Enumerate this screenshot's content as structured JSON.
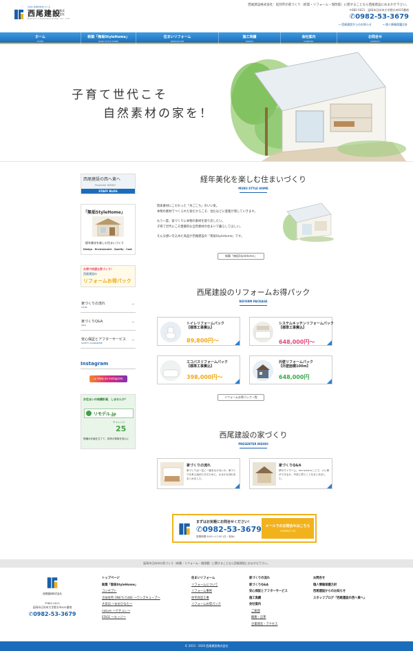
{
  "header": {
    "logo_tag": "九州に住宅文化をつくる",
    "logo_name": "西尾建設",
    "logo_suffix": "株式\n会社",
    "logo_en": "NISHIO CONSTRUCTION CO.,LTD",
    "intro": "西尾建設株式会社：延岡市の家づくり（新築・リフォーム・増改築）に関することなら西尾建設におまかせ下さい。",
    "address": "〒882-0021　延岡市日向市大字野方寺635番地",
    "phone": "0982-53-3679",
    "link_contact": "→ 西尾建設からのお知らせ",
    "link_privacy": "→ 個人情報保護方針"
  },
  "nav": [
    {
      "jp": "ホーム",
      "en": "HOME"
    },
    {
      "jp": "新築「無垢StyleHome」",
      "en": "MUKU STYLE HOME"
    },
    {
      "jp": "住まいリフォーム",
      "en": "RENOVATION"
    },
    {
      "jp": "施工実績",
      "en": "WORKS"
    },
    {
      "jp": "会社案内",
      "en": "COMPANY"
    },
    {
      "jp": "お問合せ",
      "en": "CONTACT"
    }
  ],
  "hero": {
    "copy_line1": "子育て世代こそ",
    "copy_line2": "自然素材の家を！"
  },
  "sidebar": {
    "blog_banner_title": "西尾建設の西へ東へ",
    "blog_banner_sub": "Presenter NISHIO",
    "blog_banner_en": "STAFF BLOG",
    "muku_banner_title": "「無垢StyleHome」",
    "muku_banner_sub": "経年美化を楽しむ住まいづくり",
    "muku_banner_en": "Design . Environment . Quality . Cost",
    "reform_banner_top": "お得で快適な家づくり！",
    "reform_banner_mid": "西尾建設の",
    "reform_banner_main": "リフォームお得パック",
    "menu": [
      {
        "jp": "家づくりの流れ",
        "en": "FLOW"
      },
      {
        "jp": "家づくりQ&A",
        "en": "Q&A"
      },
      {
        "jp": "安心保証とアフターサービス",
        "en": "SAFETY GUARANTEE"
      }
    ],
    "instagram_heading": "Instagram",
    "instagram_button": "View on Instagram",
    "remodel_text1": "お住まいの修繕計画、しませんか？",
    "remodel_brand": "リモデル.jp",
    "remodel_challenge": "チャレンジ",
    "remodel_num": "25",
    "remodel_text2": "修繕の計画を立てて、将来の費用を安心に"
  },
  "muku": {
    "title": "経年美化を楽しむ住まいづくり",
    "subtitle": "MUKU STYLE HOME",
    "p1a": "無垢素材にこだわった「木ごこち」のいい家。",
    "p1b": "本物の素材でつくられた家だからこそ、住むほどに愛着が増していきます。",
    "p2a": "もう一度、家づくりに本物の素材を取り戻したい。",
    "p2b": "子育て世代にこそ健康的な自然素材の住まいで暮らしてほしい。",
    "p3": "そんな想いを込めた商品が西尾建設の「無垢StyleHome」です。",
    "button": "新築「無垢StyleHome」"
  },
  "reform": {
    "title": "西尾建設のリフォームお得パック",
    "subtitle": "REFORM PACKAGE",
    "packs": [
      {
        "name": "トイレリフォームパック\n【標準工事費込】",
        "price": "89,800円〜",
        "color": "#f2a818"
      },
      {
        "name": "システムキッチンリフォームパック\n【標準工事費込】",
        "price": "648,000円〜",
        "color": "#e8457a"
      },
      {
        "name": "エコバスリフォームパック\n【標準工事費込】",
        "price": "398,000円〜",
        "color": "#f2a818"
      },
      {
        "name": "外壁リフォームパック\n【外壁面積100m】",
        "price": "648,000円",
        "color": "#3aa84b"
      }
    ],
    "button": "リフォームお得パック一覧"
  },
  "home": {
    "title": "西尾建設の家づくり",
    "subtitle": "PRESENTER NISHIO",
    "cards": [
      {
        "title": "家づくりの流れ",
        "text": "家づくりは一生に一度あるかないか。家づくりを考え始めた方のために、大まかな流れをまとめました。"
      },
      {
        "title": "家づくりQ&A",
        "text": "夢のマイホーム。построитьことで、いい家ができるか、不安に思うことをまとめました。"
      }
    ]
  },
  "contact": {
    "lead": "まずはお気軽にお問合せください！",
    "phone": "0982-53-3679",
    "hours": "営業時間 8:00〜17:00 (日・祝休)",
    "mail_button": "メールでのお問合せはこちら",
    "mail_en": "CONTACT US"
  },
  "footer": {
    "band": "延岡市日向市の家づくり（新築・リフォーム・増改築）に関することなら西尾建設におまかせ下さい。",
    "logo_caption": "西尾建設株式会社",
    "zip": "〒882-0021",
    "address": "延岡市日向市大字野方寺635番地",
    "phone": "0982-53-3679",
    "col1": [
      "トップページ",
      "新築「無垢StyleHome」",
      "コンセプト",
      "企画住宅 ONE'S CUBE 〜ワンズキューブ〜",
      "大日向 〜おおひなた〜",
      "nature 〜ナチュレ〜",
      "EDGE 〜エッジ〜"
    ],
    "col2": [
      "住まいリフォーム",
      "リフォームについて",
      "リフォーム事例",
      "住宅改造工事",
      "リフォームお得パック"
    ],
    "col3": [
      "家づくりの流れ",
      "家づくりQ&A",
      "安心保証とアフターサービス",
      "施工実績",
      "会社案内",
      "ご挨拶",
      "概要・沿革",
      "企業理念・アクセス"
    ],
    "col4": [
      "お問合せ",
      "個人情報保護方針",
      "西尾建設からのお知らせ",
      "スタッフブログ「西尾建設の西へ東へ」"
    ],
    "copyright": "© 2012 - 2020 西尾建設株式会社"
  }
}
